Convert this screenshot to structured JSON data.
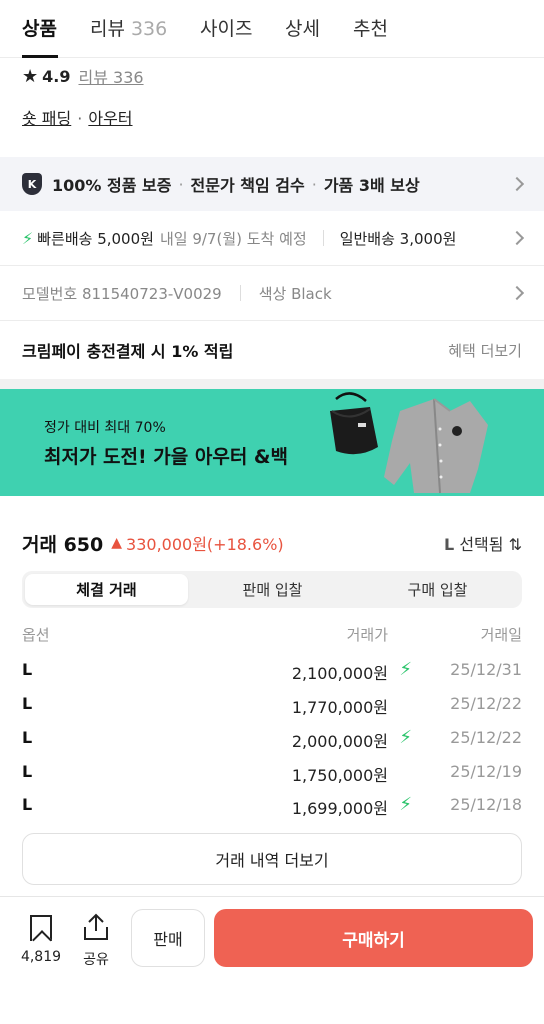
{
  "tabs": [
    {
      "label": "상품"
    },
    {
      "label": "리뷰",
      "count": "336"
    },
    {
      "label": "사이즈"
    },
    {
      "label": "상세"
    },
    {
      "label": "추천"
    }
  ],
  "rating": {
    "score": "4.9",
    "review_link": "리뷰 336"
  },
  "categories": {
    "first": "숏 패딩",
    "second": "아우터"
  },
  "guarantee": {
    "badge": "K",
    "item1": "100% 정품 보증",
    "item2": "전문가 책임 검수",
    "item3": "가품 3배 보상"
  },
  "shipping": {
    "fast": "빠른배송 5,000원",
    "eta": "내일 9/7(월) 도착 예정",
    "normal": "일반배송 3,000원"
  },
  "model": {
    "number": "모델번호 811540723-V0029",
    "color": "색상 Black"
  },
  "kream_pay": {
    "text": "크림페이 충전결제 시 1% 적립",
    "link": "혜택 더보기"
  },
  "banner": {
    "sub": "정가 대비 최대 70%",
    "main": "최저가 도전! 가을 아우터 &백"
  },
  "trades": {
    "title": "거래 650",
    "up_icon": "▲",
    "price_change": "330,000원(+18.6%)",
    "size_selected": "L",
    "size_selected_suffix": "선택됨",
    "segments": [
      "체결 거래",
      "판매 입찰",
      "구매 입찰"
    ],
    "columns": [
      "옵션",
      "거래가",
      "거래일"
    ],
    "rows": [
      {
        "option": "L",
        "price": "2,100,000원",
        "fast": true,
        "date": "25/12/31"
      },
      {
        "option": "L",
        "price": "1,770,000원",
        "fast": false,
        "date": "25/12/22"
      },
      {
        "option": "L",
        "price": "2,000,000원",
        "fast": true,
        "date": "25/12/22"
      },
      {
        "option": "L",
        "price": "1,750,000원",
        "fast": false,
        "date": "25/12/19"
      },
      {
        "option": "L",
        "price": "1,699,000원",
        "fast": true,
        "date": "25/12/18"
      }
    ],
    "more": "거래 내역 더보기"
  },
  "bottom": {
    "bookmark_count": "4,819",
    "share": "공유",
    "sell": "판매",
    "buy": "구매하기"
  },
  "colors": {
    "accent_red": "#ef6253",
    "fast_green": "#2bc46b",
    "banner_teal": "#3fd1b0"
  }
}
